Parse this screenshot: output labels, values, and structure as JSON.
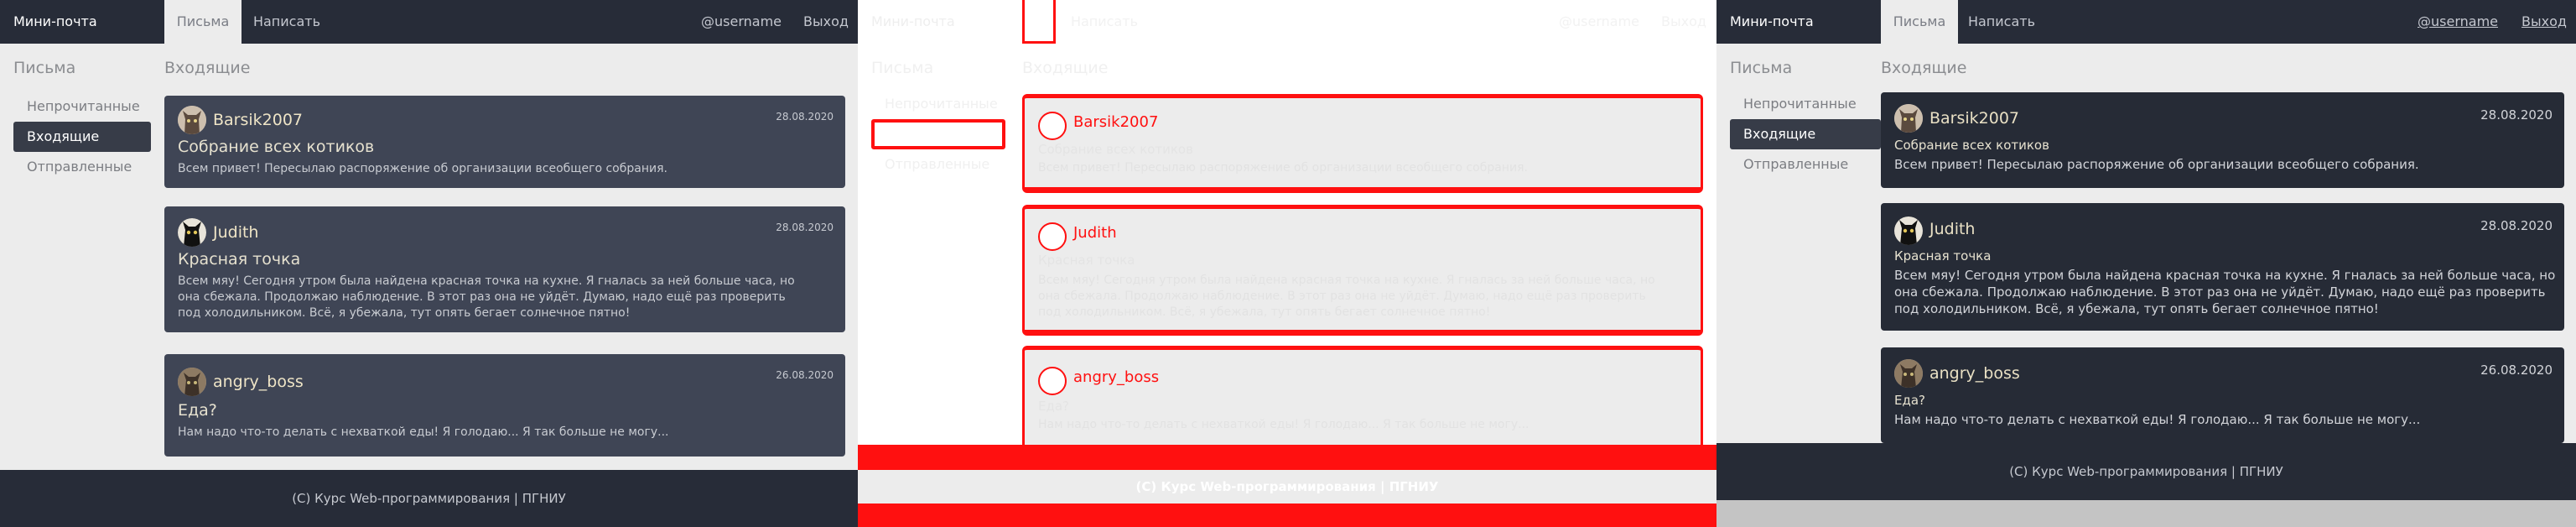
{
  "app": {
    "brand": "Мини-почта",
    "tabs": {
      "letters": "Письма",
      "compose": "Написать"
    },
    "username": "@username",
    "logout": "Выход"
  },
  "sidebar": {
    "title": "Письма",
    "items": [
      {
        "label": "Непрочитанные"
      },
      {
        "label": "Входящие",
        "active": true
      },
      {
        "label": "Отправленные"
      }
    ]
  },
  "main": {
    "title": "Входящие",
    "messages": [
      {
        "author": "Barsik2007",
        "date": "28.08.2020",
        "subject": "Собрание всех котиков",
        "body": "Всем привет! Пересылаю распоряжение об организации всеобщего собрания."
      },
      {
        "author": "Judith",
        "date": "28.08.2020",
        "subject": "Красная точка",
        "body_lines_p1": [
          "Всем мяу! Сегодня утром была найдена красная точка на кухне. Я гналась за ней больше часа, но",
          "она сбежала. Продолжаю наблюдение. В этот раз она не уйдёт. Думаю, надо ещё раз проверить",
          "под холодильником. Всё, я убежала, тут опять бегает солнечное пятно!"
        ],
        "body_lines_p3": [
          "Всем мяу! Сегодня утром была найдена красная точка на кухне. Я гналась за ней больше часа, но",
          "она сбежала. Продолжаю наблюдение. В этот раз она не уйдёт. Думаю, надо ещё раз проверить",
          "под холодильником. Всё, я убежала, тут опять бегает солнечное пятно!"
        ]
      },
      {
        "author": "angry_boss",
        "date": "26.08.2020",
        "subject": "Еда?",
        "body": "Нам надо что-то делать с нехваткой еды! Я голодаю... Я так больше не могу..."
      }
    ]
  },
  "footer": {
    "text": "(С) Курс Web-программирования | ПГНИУ"
  },
  "colors": {
    "header_bg": "#272c38",
    "card_bg_light": "#3f4555",
    "card_bg_dark": "#262b36",
    "highlight_red": "#ff1010",
    "page_bg": "#ececec"
  },
  "icons": {
    "avatar_1": "cat-avatar-icon",
    "avatar_2": "black-cat-avatar-icon",
    "avatar_3": "cat-avatar-icon"
  }
}
